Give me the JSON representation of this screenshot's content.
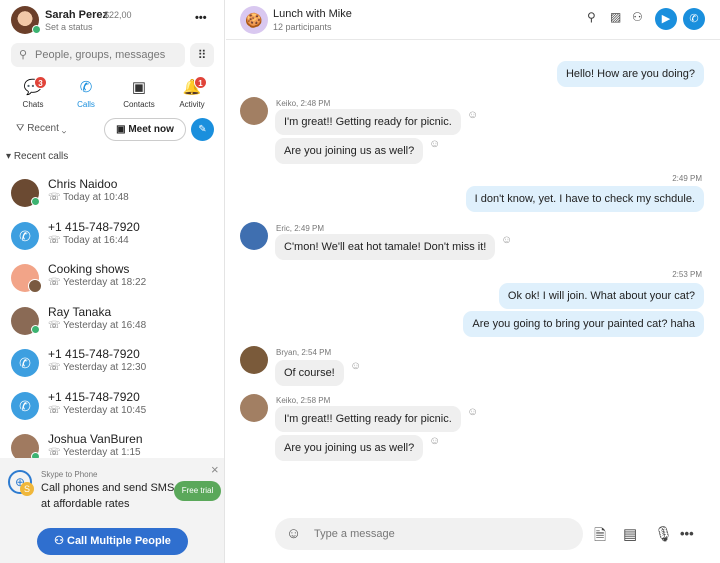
{
  "profile": {
    "name": "Sarah Perez",
    "balance": "$22,00",
    "status": "Set a status",
    "more": "•••"
  },
  "search": {
    "placeholder": "People, groups, messages"
  },
  "tabs": [
    {
      "label": "Chats",
      "badge": "3"
    },
    {
      "label": "Calls"
    },
    {
      "label": "Contacts"
    },
    {
      "label": "Activity",
      "badge": "1"
    }
  ],
  "filter": {
    "label": "Recent"
  },
  "meet_now": "Meet now",
  "section": "Recent calls",
  "calls": [
    {
      "name": "Chris Naidoo",
      "time": "Today at 10:48",
      "type": "avatar",
      "color": "#6b4a32"
    },
    {
      "name": "+1 415-748-7920",
      "time": "Today at 16:44",
      "type": "phone"
    },
    {
      "name": "Cooking shows",
      "time": "Yesterday at 18:22",
      "type": "group",
      "color": "#f2a488"
    },
    {
      "name": "Ray Tanaka",
      "time": "Yesterday at 16:48",
      "type": "avatar",
      "color": "#8a6a55"
    },
    {
      "name": "+1 415-748-7920",
      "time": "Yesterday at 12:30",
      "type": "phone"
    },
    {
      "name": "+1 415-748-7920",
      "time": "Yesterday at 10:45",
      "type": "phone"
    },
    {
      "name": "Joshua VanBuren",
      "time": "Yesterday at 1:15",
      "type": "avatar",
      "color": "#a07a60"
    }
  ],
  "promo": {
    "title": "Skype to Phone",
    "text1": "Call phones and send SMS",
    "text2": "at affordable rates",
    "cta": "Free trial",
    "close": "×"
  },
  "call_multiple": "Call Multiple People",
  "chat": {
    "title": "Lunch with Mike",
    "participants": "12 participants"
  },
  "messages": [
    {
      "dir": "out",
      "text": "Hello! How are you doing?"
    },
    {
      "meta": "Keiko, 2:48 PM"
    },
    {
      "dir": "in",
      "text": "I'm great!! Getting ready for picnic."
    },
    {
      "dir": "in",
      "text": "Are you joining us as well?"
    },
    {
      "meta": "2:49 PM"
    },
    {
      "dir": "out",
      "text": "I don't know, yet. I have to check my schdule."
    },
    {
      "meta": "Eric, 2:49 PM"
    },
    {
      "dir": "in",
      "text": "C'mon! We'll eat hot tamale! Don't miss it!"
    },
    {
      "meta": "2:53 PM"
    },
    {
      "dir": "out",
      "text": "Ok ok! I will join. What about your cat?"
    },
    {
      "dir": "out",
      "text": "Are you going to bring your painted cat? haha"
    },
    {
      "meta": "Bryan, 2:54 PM"
    },
    {
      "dir": "in",
      "text": "Of course!"
    },
    {
      "meta": "Keiko, 2:58 PM"
    },
    {
      "dir": "in",
      "text": "I'm great!! Getting ready for picnic."
    },
    {
      "dir": "in",
      "text": "Are you joining us as well?"
    }
  ],
  "composer": {
    "placeholder": "Type a message"
  },
  "colors": {
    "accent": "#1a8fdd",
    "bubble_out": "#dff0fc",
    "bubble_in": "#efefef",
    "green": "#5aa85a",
    "cta_blue": "#2f6fcf"
  }
}
